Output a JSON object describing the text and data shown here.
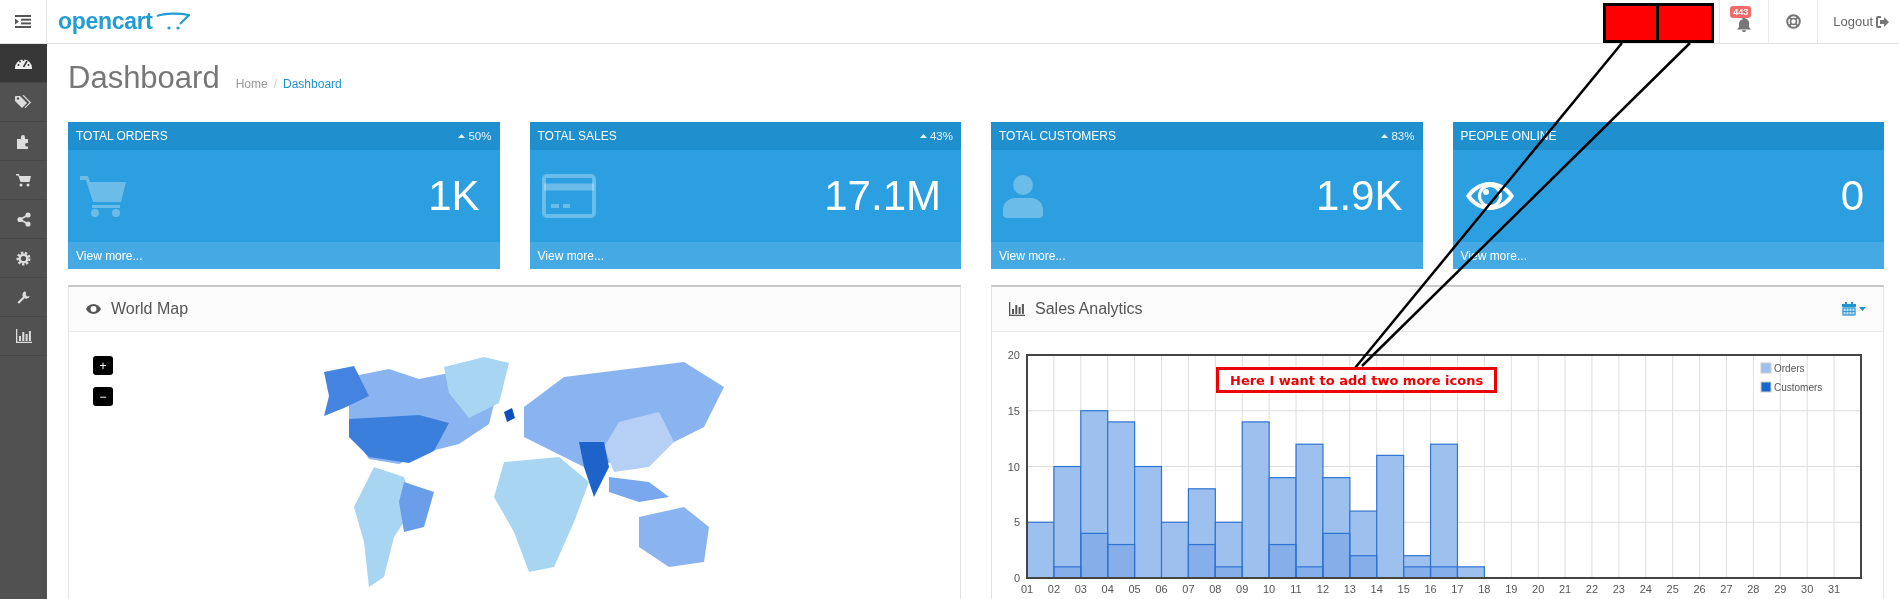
{
  "header": {
    "logo": "opencart",
    "notifications": "443",
    "logout": "Logout"
  },
  "sidebar": {
    "items": [
      {
        "kind": "dashboard",
        "selected": true
      },
      {
        "kind": "tag",
        "selected": false
      },
      {
        "kind": "puzzle",
        "selected": false
      },
      {
        "kind": "cart",
        "selected": false
      },
      {
        "kind": "share",
        "selected": false
      },
      {
        "kind": "gear",
        "selected": false
      },
      {
        "kind": "wrench",
        "selected": false
      },
      {
        "kind": "bar-chart",
        "selected": false
      }
    ]
  },
  "page": {
    "title": "Dashboard",
    "breadcrumb": {
      "items": [
        "Home",
        "Dashboard"
      ],
      "separator": "/"
    }
  },
  "tiles": [
    {
      "kind": "cart",
      "title": "TOTAL ORDERS",
      "change": "50%",
      "value": "1K",
      "link": "View more..."
    },
    {
      "kind": "credit-card",
      "title": "TOTAL SALES",
      "change": "43%",
      "value": "17.1M",
      "link": "View more..."
    },
    {
      "kind": "user",
      "title": "TOTAL CUSTOMERS",
      "change": "83%",
      "value": "1.9K",
      "link": "View more..."
    },
    {
      "kind": "eye",
      "title": "PEOPLE ONLINE",
      "value": "0",
      "link": "View more..."
    }
  ],
  "world_map": {
    "title": "World Map",
    "zoom_controls": [
      "+",
      "−"
    ]
  },
  "sales_analytics": {
    "title": "Sales Analytics",
    "chart_data": {
      "type": "bar",
      "categories": [
        "01",
        "02",
        "03",
        "04",
        "05",
        "06",
        "07",
        "08",
        "09",
        "10",
        "11",
        "12",
        "13",
        "14",
        "15",
        "16",
        "17",
        "18",
        "19",
        "20",
        "21",
        "22",
        "23",
        "24",
        "25",
        "26",
        "27",
        "28",
        "29",
        "30",
        "31"
      ],
      "series": [
        {
          "name": "Orders",
          "color": "#9ec0ee",
          "values": [
            5,
            10,
            15,
            14,
            10,
            5,
            8,
            5,
            14,
            9,
            12,
            9,
            6,
            11,
            2,
            12,
            1,
            0,
            0,
            0,
            0,
            0,
            0,
            0,
            0,
            0,
            0,
            0,
            0,
            0,
            0
          ]
        },
        {
          "name": "Customers",
          "color": "#1a66d1",
          "values": [
            0,
            1,
            4,
            3,
            0,
            0,
            3,
            1,
            0,
            3,
            1,
            4,
            2,
            0,
            1,
            1,
            0,
            0,
            0,
            0,
            0,
            0,
            0,
            0,
            0,
            0,
            0,
            0,
            0,
            0,
            0
          ]
        }
      ],
      "ylim": [
        0,
        20
      ],
      "yticks": [
        0,
        5,
        10,
        15,
        20
      ],
      "stacked": false,
      "grid": true,
      "legend": true
    }
  },
  "annotation": {
    "label": "Here I want to add two more icons",
    "slots": [
      {
        "kind": "empty-slot"
      },
      {
        "kind": "empty-slot"
      }
    ]
  }
}
